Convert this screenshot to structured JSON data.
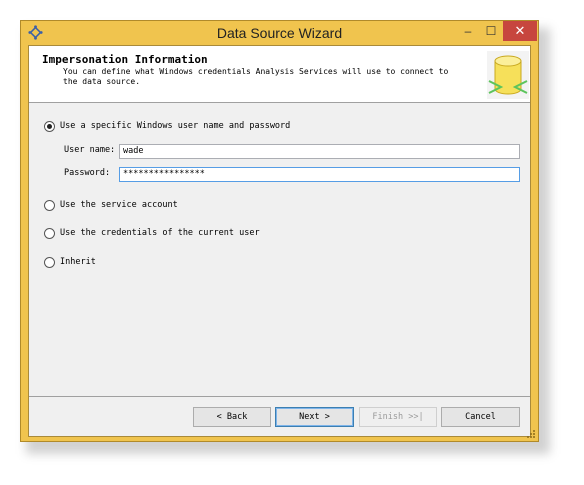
{
  "window": {
    "title": "Data Source Wizard",
    "minimize_label": "–",
    "maximize_label": "☐",
    "close_label": "✕"
  },
  "header": {
    "title": "Impersonation Information",
    "description_line1": "You can define what Windows credentials Analysis Services will use to connect to",
    "description_line2": "the data source."
  },
  "options": {
    "specific_user": {
      "label": "Use a specific Windows user name and password",
      "checked": true
    },
    "service_account": {
      "label": "Use the service account",
      "checked": false
    },
    "current_user": {
      "label": "Use the credentials of the current user",
      "checked": false
    },
    "inherit": {
      "label": "Inherit",
      "checked": false
    }
  },
  "fields": {
    "username": {
      "label": "User name:",
      "value": "wade"
    },
    "password": {
      "label": "Password:",
      "value": "****************"
    }
  },
  "buttons": {
    "back": "< Back",
    "next": "Next >",
    "finish": "Finish >>|",
    "cancel": "Cancel"
  },
  "colors": {
    "window_frame": "#f0c44e",
    "close_button": "#c7463e",
    "focus_border": "#569de5"
  }
}
